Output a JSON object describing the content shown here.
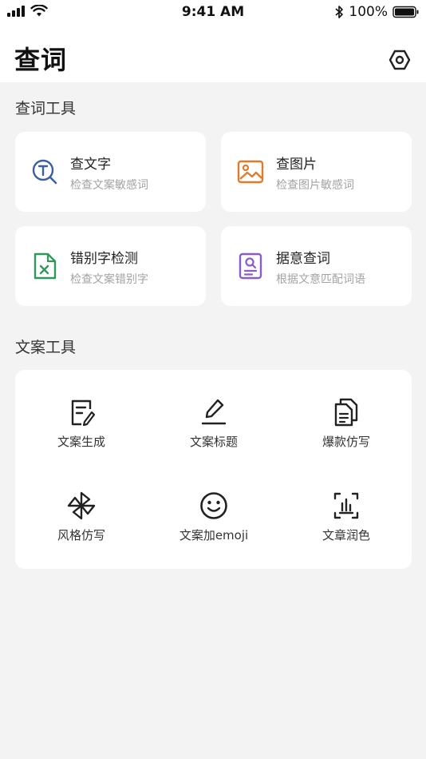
{
  "status_bar": {
    "time": "9:41 AM",
    "battery": "100%"
  },
  "header": {
    "title": "查词"
  },
  "lookup_section": {
    "title": "查词工具",
    "cards": [
      {
        "title": "查文字",
        "subtitle": "检查文案敏感词",
        "icon": "text-search-icon",
        "color": "#3b5fa0"
      },
      {
        "title": "查图片",
        "subtitle": "检查图片敏感词",
        "icon": "image-icon",
        "color": "#e07b2c"
      },
      {
        "title": "错别字检测",
        "subtitle": "检查文案错别字",
        "icon": "excel-file-icon",
        "color": "#2e9a5a"
      },
      {
        "title": "据意查词",
        "subtitle": "根据文意匹配词语",
        "icon": "document-search-icon",
        "color": "#8a5cc8"
      }
    ]
  },
  "copy_section": {
    "title": "文案工具",
    "tools": [
      {
        "label": "文案生成",
        "icon": "document-edit-icon"
      },
      {
        "label": "文案标题",
        "icon": "pen-underline-icon"
      },
      {
        "label": "爆款仿写",
        "icon": "documents-copy-icon"
      },
      {
        "label": "风格仿写",
        "icon": "pinwheel-icon"
      },
      {
        "label": "文案加emoji",
        "icon": "smiley-icon"
      },
      {
        "label": "文章润色",
        "icon": "audio-bars-icon"
      }
    ]
  }
}
